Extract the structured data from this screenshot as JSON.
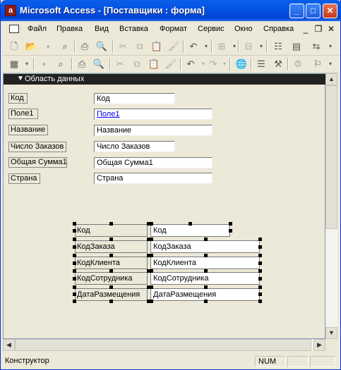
{
  "window": {
    "title": "Microsoft Access - [Поставщики : форма]",
    "app_icon_letter": "a",
    "controls": {
      "minimize": "_",
      "maximize": "□",
      "close": "✕"
    }
  },
  "menubar": {
    "items": [
      "Файл",
      "Правка",
      "Вид",
      "Вставка",
      "Формат",
      "Сервис",
      "Окно",
      "Справка"
    ],
    "mdi_controls": {
      "minimize": "_",
      "restore": "❐",
      "close": "✕"
    }
  },
  "section": {
    "label": "Область данных",
    "arrow": "▼"
  },
  "form_fields": [
    {
      "label": "Код",
      "value": "Код"
    },
    {
      "label": "Поле1",
      "value": "Поле1"
    },
    {
      "label": "Название",
      "value": "Название"
    },
    {
      "label": "Число Заказов",
      "value": "Число Заказов"
    },
    {
      "label": "Общая Сумма1",
      "value": "Общая Сумма1"
    },
    {
      "label": "Страна",
      "value": "Страна"
    }
  ],
  "selected_fields": [
    {
      "label": "Код",
      "value": "Код"
    },
    {
      "label": "КодЗаказа",
      "value": "КодЗаказа"
    },
    {
      "label": "КодКлиента",
      "value": "КодКлиента"
    },
    {
      "label": "КодСотрудника",
      "value": "КодСотрудника"
    },
    {
      "label": "ДатаРазмещения",
      "value": "ДатаРазмещения"
    }
  ],
  "statusbar": {
    "mode": "Конструктор",
    "num": "NUM"
  },
  "colors": {
    "titlebar": "#0A5FE8",
    "section_bar": "#222222",
    "link": "#0000EE"
  }
}
